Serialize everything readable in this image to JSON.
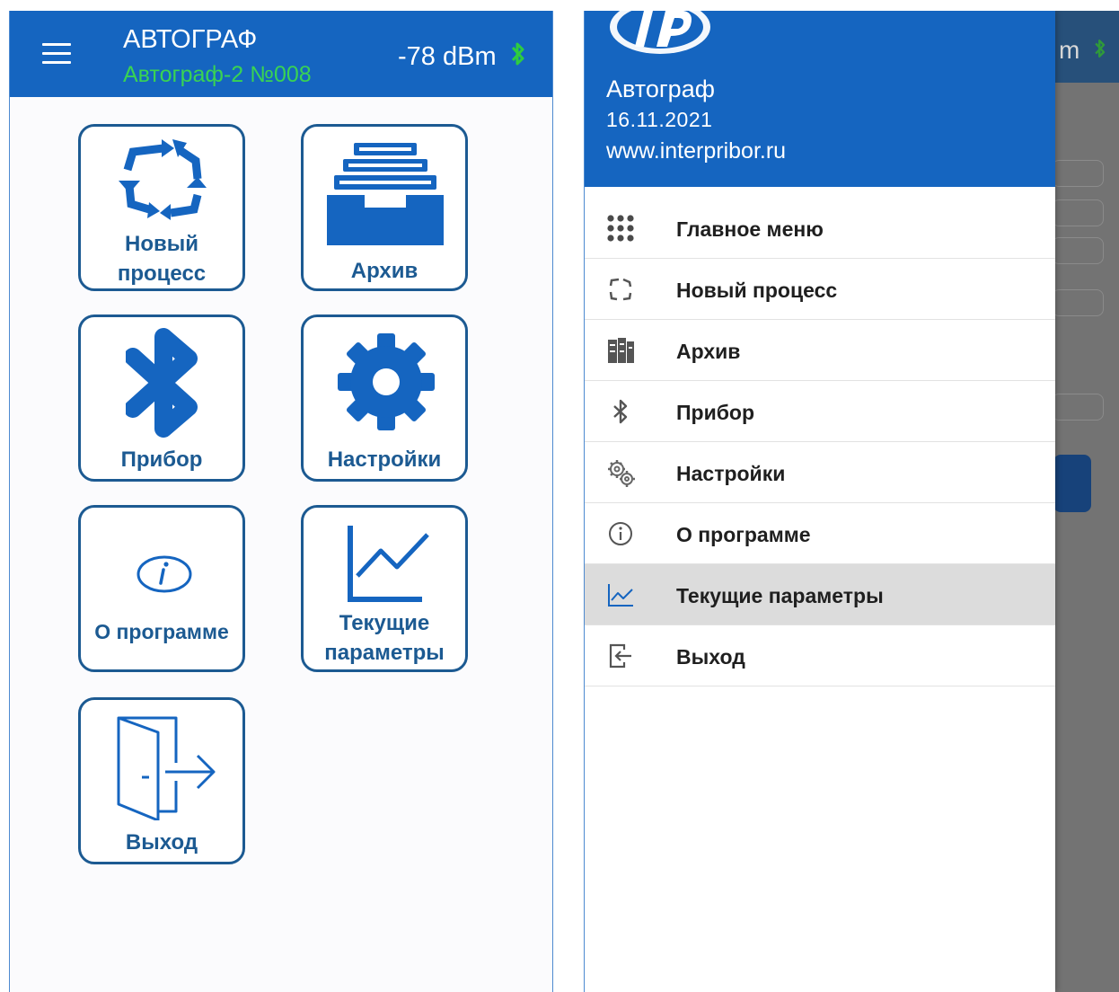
{
  "main_screen": {
    "title": "АВТОГРАФ",
    "device": "Автограф-2 №008",
    "signal": "-78 dBm",
    "tiles": {
      "new_process": [
        "Новый",
        "процесс"
      ],
      "archive": "Архив",
      "device": "Прибор",
      "settings": "Настройки",
      "about": "О программе",
      "current_params": [
        "Текущие",
        "параметры"
      ],
      "exit": "Выход"
    }
  },
  "drawer": {
    "app_name": "Автограф",
    "date": "16.11.2021",
    "website": "www.interpribor.ru",
    "background_signal_fragment": "m",
    "items": [
      {
        "label": "Главное меню",
        "icon": "grid-icon"
      },
      {
        "label": "Новый процесс",
        "icon": "refresh-arrows-icon"
      },
      {
        "label": "Архив",
        "icon": "archive-icon"
      },
      {
        "label": "Прибор",
        "icon": "bluetooth-icon"
      },
      {
        "label": "Настройки",
        "icon": "gears-icon"
      },
      {
        "label": "О программе",
        "icon": "info-icon"
      },
      {
        "label": "Текущие параметры",
        "icon": "chart-icon",
        "active": true
      },
      {
        "label": "Выход",
        "icon": "exit-icon"
      }
    ]
  },
  "colors": {
    "primary": "#1565c0",
    "tile_border": "#1c5a92",
    "device_green": "#39d353",
    "bluetooth_green": "#2ecc40",
    "active_row": "#dcdcdc"
  }
}
